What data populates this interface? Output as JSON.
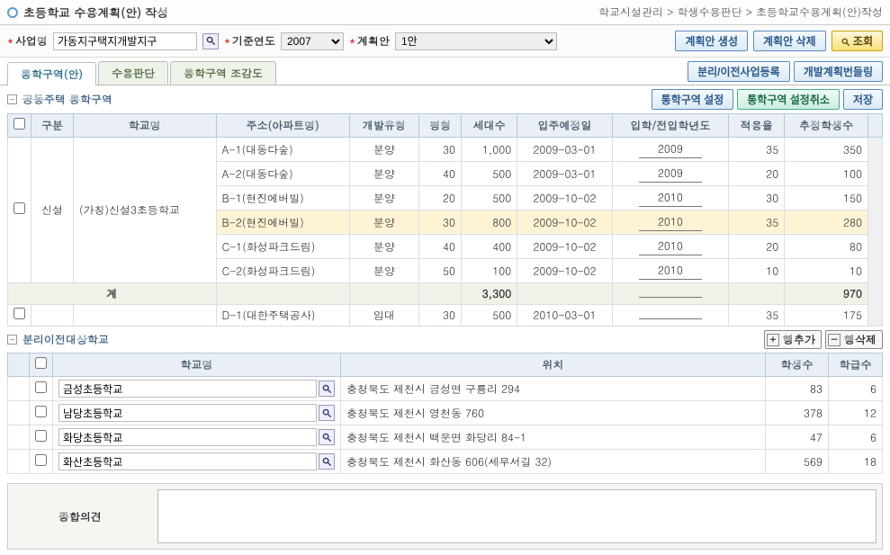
{
  "header": {
    "title": "초등학교 수용계획(안) 작성",
    "breadcrumb": "학교시설관리 > 학생수용판단 > 초등학교수용계획(안)작성"
  },
  "filter": {
    "label_biz": "사업명",
    "biz_value": "가동지구택지개발지구",
    "label_year": "기준연도",
    "year_value": "2007",
    "label_plan": "계획안",
    "plan_value": "1안",
    "btn_create": "계획안 생성",
    "btn_delete": "계획안 삭제",
    "btn_search": "조회"
  },
  "tabs": {
    "tab1": "통학구역(안)",
    "tab2": "수용판단",
    "tab3": "통학구역 조감도",
    "btn_reg": "분리/이전사업등록",
    "btn_bundle": "개발계획번들링"
  },
  "section1": {
    "title": "공동주택 통학구역",
    "btn_set": "통학구역 설정",
    "btn_cancel": "통학구역 설정취소",
    "btn_save": "저장",
    "cols": {
      "gubun": "구분",
      "school": "학교명",
      "addr": "주소(아파트명)",
      "devtype": "개발유형",
      "pyeong": "평형",
      "units": "세대수",
      "movein": "입주예정일",
      "enroll": "입학/전입학년도",
      "rate": "적용율",
      "est": "추정학생수"
    },
    "gubun_val": "신설",
    "school_val": "(가칭)신설3초등학교",
    "rows": [
      {
        "addr": "A-1(대동다숲)",
        "dev": "분양",
        "py": "30",
        "units": "1,000",
        "date": "2009-03-01",
        "year": "2009",
        "rate": "35",
        "est": "350"
      },
      {
        "addr": "A-2(대동다숲)",
        "dev": "분양",
        "py": "40",
        "units": "500",
        "date": "2009-03-01",
        "year": "2009",
        "rate": "20",
        "est": "100"
      },
      {
        "addr": "B-1(현진에버빌)",
        "dev": "분양",
        "py": "20",
        "units": "500",
        "date": "2009-10-02",
        "year": "2010",
        "rate": "30",
        "est": "150"
      },
      {
        "addr": "B-2(현진에버빌)",
        "dev": "분양",
        "py": "30",
        "units": "800",
        "date": "2009-10-02",
        "year": "2010",
        "rate": "35",
        "est": "280"
      },
      {
        "addr": "C-1(화성파크드림)",
        "dev": "분양",
        "py": "40",
        "units": "400",
        "date": "2009-10-02",
        "year": "2010",
        "rate": "20",
        "est": "80"
      },
      {
        "addr": "C-2(화성파크드림)",
        "dev": "분양",
        "py": "50",
        "units": "100",
        "date": "2009-10-02",
        "year": "2010",
        "rate": "10",
        "est": "10"
      }
    ],
    "total": {
      "label": "계",
      "units": "3,300",
      "est": "970"
    },
    "row_after": {
      "addr": "D-1(대한주택공사)",
      "dev": "임대",
      "py": "30",
      "units": "500",
      "date": "2010-03-01",
      "year": "",
      "rate": "35",
      "est": "175"
    }
  },
  "section2": {
    "title": "분리이전대상학교",
    "btn_add": "행추가",
    "btn_del": "행삭제",
    "cols": {
      "school": "학교명",
      "loc": "위치",
      "students": "학생수",
      "classes": "학급수"
    },
    "rows": [
      {
        "school": "금성초등학교",
        "loc": "충청북도 제천시 금성면 구룡리 294",
        "stu": "83",
        "cls": "6"
      },
      {
        "school": "남당초등학교",
        "loc": "충청북도 제천시 영천동 760",
        "stu": "378",
        "cls": "12"
      },
      {
        "school": "화당초등학교",
        "loc": "충청북도 제천시 백운면 화당리 84-1",
        "stu": "47",
        "cls": "6"
      },
      {
        "school": "화산초등학교",
        "loc": "충청북도 제천시 화산동 606(세무서길 32)",
        "stu": "569",
        "cls": "18"
      }
    ]
  },
  "opinion": {
    "label": "종합의견",
    "value": ""
  }
}
